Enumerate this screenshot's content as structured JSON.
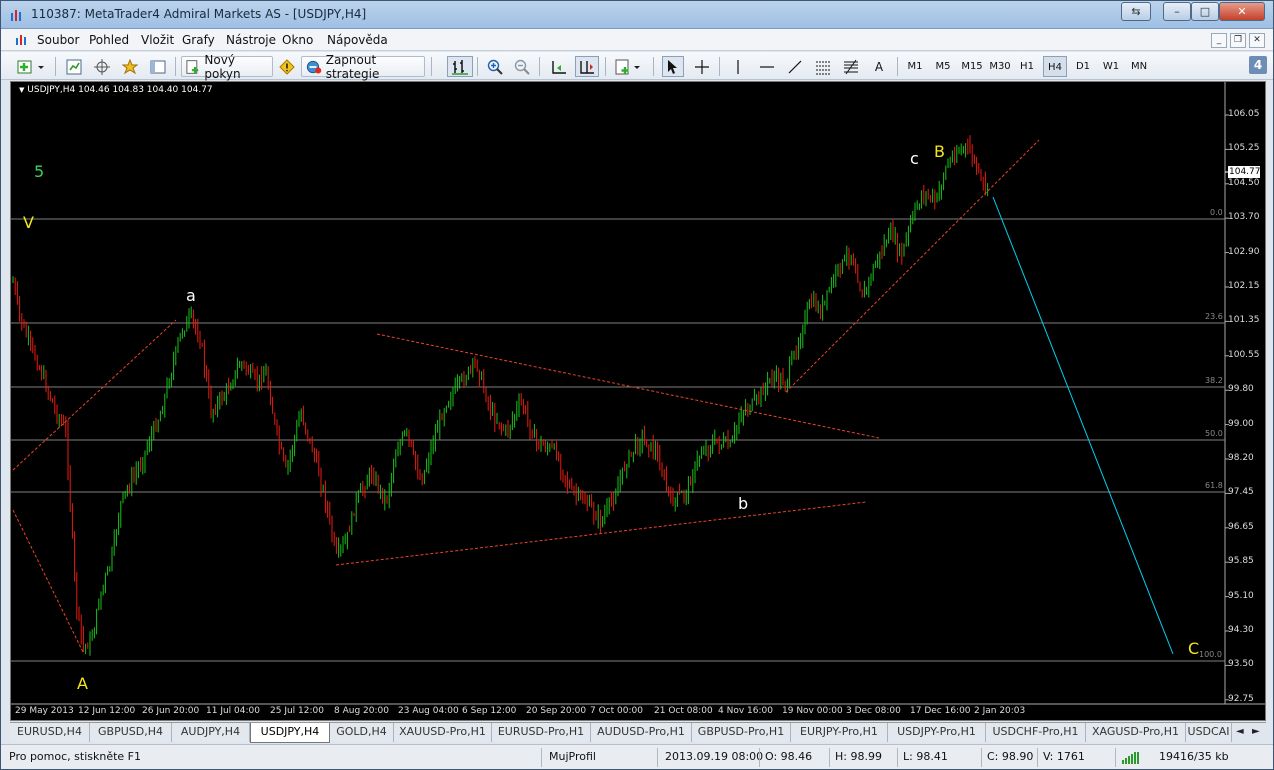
{
  "window": {
    "title": "110387: MetaTrader4 Admiral Markets AS - [USDJPY,H4]",
    "min_label": "–",
    "max_label": "□",
    "close_label": "✕",
    "restore_label": "⇆"
  },
  "menu": {
    "items": [
      "Soubor",
      "Pohled",
      "Vložit",
      "Grafy",
      "Nástroje",
      "Okno",
      "Nápověda"
    ]
  },
  "toolbar": {
    "new_order": "Nový pokyn",
    "strategy": "Zapnout strategie",
    "text_tool": "A",
    "timeframes": [
      "M1",
      "M5",
      "M15",
      "M30",
      "H1",
      "H4",
      "D1",
      "W1",
      "MN"
    ],
    "active_timeframe": "H4",
    "badge": "4"
  },
  "chart": {
    "header": "USDJPY,H4  104.46 104.83 104.40 104.77",
    "current_price": "104.77",
    "price_labels": [
      "106.05",
      "105.25",
      "104.50",
      "103.70",
      "102.90",
      "102.15",
      "101.35",
      "100.55",
      "99.80",
      "99.00",
      "98.20",
      "97.45",
      "96.65",
      "95.85",
      "95.10",
      "94.30",
      "93.50",
      "92.75"
    ],
    "date_labels": [
      "29 May 2013",
      "12 Jun 12:00",
      "26 Jun 20:00",
      "11 Jul 04:00",
      "25 Jul 12:00",
      "8 Aug 20:00",
      "23 Aug 04:00",
      "6 Sep 12:00",
      "20 Sep 20:00",
      "7 Oct 00:00",
      "21 Oct 08:00",
      "4 Nov 16:00",
      "19 Nov 00:00",
      "3 Dec 08:00",
      "17 Dec 16:00",
      "2 Jan 20:03"
    ],
    "fib_labels": [
      "0.0",
      "23.6",
      "38.2",
      "50.0",
      "61.8",
      "100.0"
    ],
    "wave_labels": {
      "five": "5",
      "v": "V",
      "a_small": "a",
      "a_big": "A",
      "b_small": "b",
      "c_small": "c",
      "b_big": "B",
      "c_big": "C"
    },
    "colors": {
      "bull": "#18c218",
      "bear": "#e81c0e",
      "trend": "#e8452a",
      "projection": "#00d2f0",
      "fib": "#808080",
      "wave_yellow": "#f5e61e",
      "wave_green": "#3cd25a"
    }
  },
  "tabs": {
    "items": [
      "EURUSD,H4",
      "GBPUSD,H4",
      "AUDJPY,H4",
      "USDJPY,H4",
      "GOLD,H4",
      "XAUUSD-Pro,H1",
      "EURUSD-Pro,H1",
      "AUDUSD-Pro,H1",
      "GBPUSD-Pro,H1",
      "EURJPY-Pro,H1",
      "USDJPY-Pro,H1",
      "USDCHF-Pro,H1",
      "XAGUSD-Pro,H1",
      "USDCAI"
    ],
    "active": "USDJPY,H4",
    "prev": "◄",
    "next": "►"
  },
  "status": {
    "help": "Pro pomoc, stiskněte F1",
    "profile": "MujProfil",
    "datetime": "2013.09.19 08:00",
    "open": "O: 98.46",
    "high": "H: 98.99",
    "low": "L: 98.41",
    "close": "C: 98.90",
    "volume": "V: 1761",
    "traffic": "19416/35 kb"
  }
}
